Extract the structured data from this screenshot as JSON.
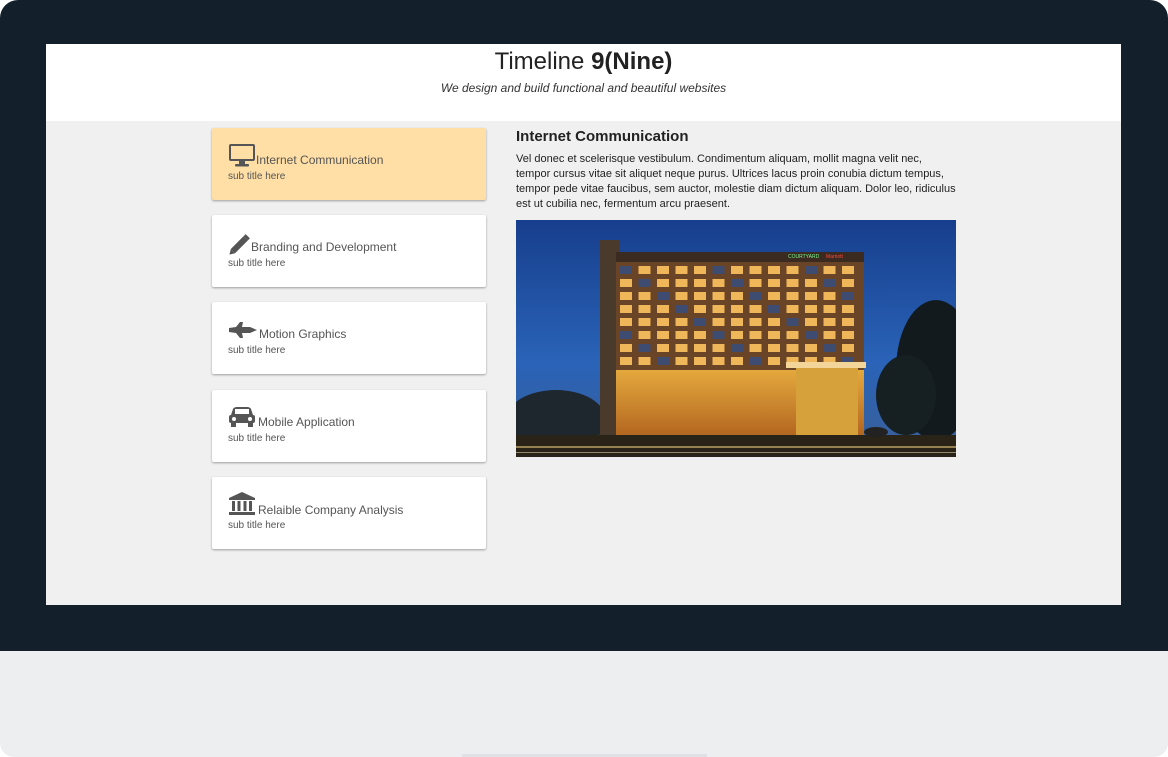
{
  "header": {
    "title_normal": "Timeline",
    "title_bold": "9(Nine)",
    "tagline": "We design and build functional and beautiful websites"
  },
  "tabs": [
    {
      "label": "Internet Communication",
      "subtitle": "sub title here",
      "icon": "desktop-icon",
      "active": true
    },
    {
      "label": "Branding and Development",
      "subtitle": "sub title here",
      "icon": "pencil-icon",
      "active": false
    },
    {
      "label": "Motion Graphics",
      "subtitle": "sub title here",
      "icon": "space-shuttle-icon",
      "active": false
    },
    {
      "label": "Mobile Application",
      "subtitle": "sub title here",
      "icon": "car-icon",
      "active": false
    },
    {
      "label": "Relaible Company Analysis",
      "subtitle": "sub title here",
      "icon": "bank-icon",
      "active": false
    }
  ],
  "content": {
    "title": "Internet Communication",
    "text": "Vel donec et scelerisque vestibulum. Condimentum aliquam, mollit magna velit nec, tempor cursus vitae sit aliquet neque purus. Ultrices lacus proin conubia dictum tempus, tempor pede vitae faucibus, sem auctor, molestie diam dictum aliquam. Dolor leo, ridiculus est ut cubilia nec, fermentum arcu praesent.",
    "image_sign_left": "COURTYARD",
    "image_sign_right": "Marriott"
  },
  "colors": {
    "monitor_frame": "#13202b",
    "monitor_base": "#eceeef",
    "screen_bg": "#f0f0f0",
    "active_tab": "#ffdfa6",
    "tab_bg": "#ffffff",
    "text": "#555555"
  }
}
